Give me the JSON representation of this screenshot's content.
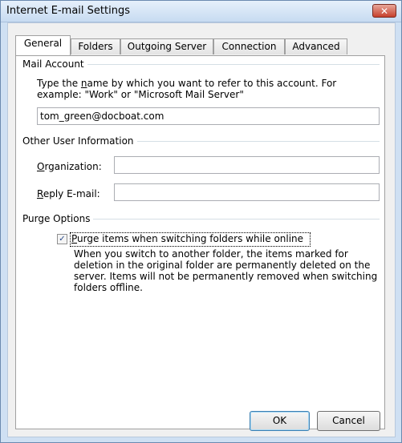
{
  "window": {
    "title": "Internet E-mail Settings",
    "close_glyph": "✕"
  },
  "tabs": [
    {
      "label": "General",
      "active": true
    },
    {
      "label": "Folders",
      "active": false
    },
    {
      "label": "Outgoing Server",
      "active": false
    },
    {
      "label": "Connection",
      "active": false
    },
    {
      "label": "Advanced",
      "active": false
    }
  ],
  "mail_account": {
    "heading": "Mail Account",
    "instructions_line1": "Type the name by which you want to refer to this account. For",
    "instructions_line2": "example: \"Work\" or \"Microsoft Mail Server\"",
    "account_name": "tom_green@docboat.com"
  },
  "other_user_info": {
    "heading": "Other User Information",
    "organization_label": "Organization:",
    "organization_value": "",
    "reply_email_label": "Reply E-mail:",
    "reply_email_value": ""
  },
  "purge_options": {
    "heading": "Purge Options",
    "checkbox_label": "Purge items when switching folders while online",
    "checked": true,
    "description_lines": [
      "When you switch to another folder, the items marked for",
      "deletion in the original folder are permanently deleted on the",
      "server. Items will not be permanently removed when switching",
      "folders offline."
    ]
  },
  "buttons": {
    "ok": "OK",
    "cancel": "Cancel"
  }
}
